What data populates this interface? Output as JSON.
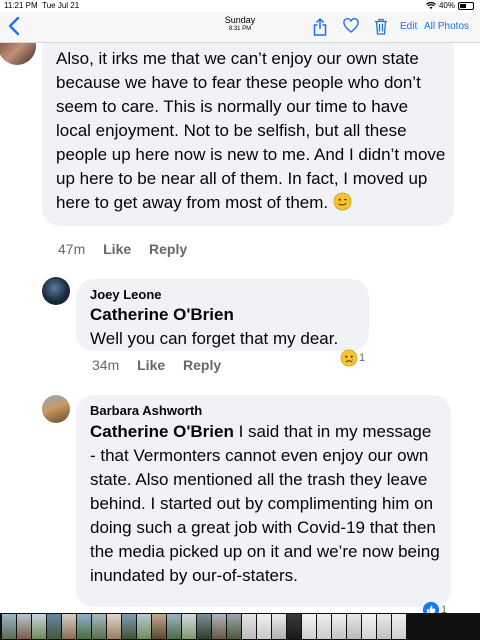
{
  "status_bar": {
    "time": "11:21 PM",
    "date": "Tue Jul 21",
    "battery": "40%"
  },
  "nav": {
    "day": "Sunday",
    "time": "8:31 PM",
    "edit": "Edit",
    "all_photos": "All Photos"
  },
  "comments": [
    {
      "text": "Also, it irks me that we can’t enjoy our own state because we have to fear these people who don’t seem to care. This is normally our time to have local enjoyment. Not to be selfish, but all these people up here now is new to me. And I didn’t move up here to be near all of them. In fact, I moved up here to get away from most of them.",
      "time": "47m",
      "like": "Like",
      "reply": "Reply"
    },
    {
      "author": "Joey Leone",
      "mention": "Catherine O'Brien",
      "text": "Well you can forget that my dear.",
      "time": "34m",
      "like": "Like",
      "reply": "Reply",
      "reaction_count": "1"
    },
    {
      "author": "Barbara Ashworth",
      "mention": "Catherine O'Brien",
      "text": " I said that in my message - that Vermonters cannot even enjoy our own state. Also mentioned all the trash they leave behind. I started out by complimenting him on doing such a great job with Covid-19 that then the media picked up on it and we’re now being inundated by our-of-staters.",
      "reaction_count": "1"
    }
  ],
  "colors": {
    "bubble": "#f0f2f5",
    "link": "#1a73e8",
    "meta": "#65676b",
    "like_blue": "#1877f2"
  },
  "icons": [
    "back-chevron-icon",
    "share-icon",
    "heart-icon",
    "trash-icon",
    "wifi-icon",
    "battery-icon",
    "wink-emoji-icon",
    "sad-emoji-icon",
    "like-thumb-icon"
  ]
}
